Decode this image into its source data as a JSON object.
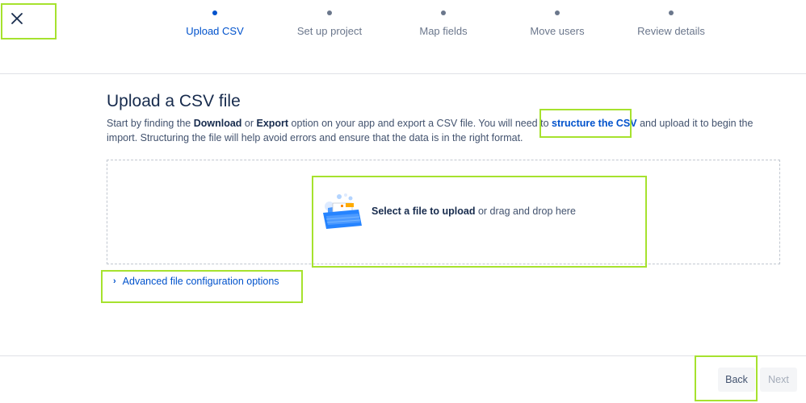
{
  "stepper": {
    "steps": [
      {
        "label": "Upload CSV",
        "active": true
      },
      {
        "label": "Set up project",
        "active": false
      },
      {
        "label": "Map fields",
        "active": false
      },
      {
        "label": "Move users",
        "active": false
      },
      {
        "label": "Review details",
        "active": false
      }
    ]
  },
  "main": {
    "title": "Upload a CSV file",
    "description": {
      "p1": "Start by finding the ",
      "download": "Download",
      "p2": " or ",
      "export": "Export",
      "p3": " option on your app and export a CSV file. You will need to ",
      "link": "structure the CSV",
      "p4": " and upload it to begin the import. Structuring the file will help avoid errors and ensure that the data is in the right format."
    },
    "dropzone": {
      "link": "Select a file to upload",
      "suffix": " or drag and drop here"
    },
    "advanced_label": "Advanced file configuration options"
  },
  "footer": {
    "back_label": "Back",
    "next_label": "Next"
  },
  "colors": {
    "accent": "#0052CC",
    "text": "#172B4D",
    "muted": "#6B778C",
    "highlight": "#a6e22e"
  },
  "icons": {
    "close": "close-icon",
    "upload_illustration": "upload-folder-illustration",
    "chevron": "chevron-right-icon"
  }
}
